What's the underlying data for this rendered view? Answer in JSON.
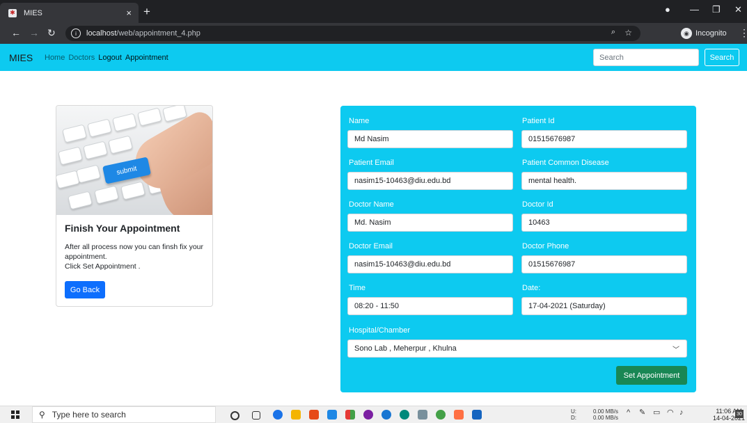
{
  "browser": {
    "tab_title": "MIES",
    "tab_close": "×",
    "new_tab": "+",
    "url_host": "localhost",
    "url_path": "/web/appointment_4.php",
    "incognito_label": "Incognito"
  },
  "navbar": {
    "brand": "MIES",
    "links": [
      "Home",
      "Doctors",
      "Logout",
      "Appointment"
    ],
    "search_placeholder": "Search",
    "search_button": "Search",
    "bg_color": "#0dcaf0"
  },
  "card": {
    "image_key_label": "submit",
    "title": "Finish Your Appointment",
    "text_line1": "After all process now you can finsh fix your appointment.",
    "text_line2": "Click Set Appointment .",
    "button": "Go Back"
  },
  "form": {
    "name_label": "Name",
    "name_value": "Md Nasim",
    "patient_id_label": "Patient Id",
    "patient_id_value": "01515676987",
    "patient_email_label": "Patient Email",
    "patient_email_value": "nasim15-10463@diu.edu.bd",
    "disease_label": "Patient Common Disease",
    "disease_value": "mental health.",
    "doctor_name_label": "Doctor Name",
    "doctor_name_value": "Md. Nasim",
    "doctor_id_label": "Doctor Id",
    "doctor_id_value": "10463",
    "doctor_email_label": "Doctor Email",
    "doctor_email_value": "nasim15-10463@diu.edu.bd",
    "doctor_phone_label": "Doctor Phone",
    "doctor_phone_value": "01515676987",
    "time_label": "Time",
    "time_value": "08:20 - 11:50",
    "date_label": "Date:",
    "date_value": "17-04-2021 (Saturday)",
    "hospital_label": "Hospital/Chamber",
    "hospital_value": "Sono Lab , Meherpur , Khulna",
    "submit_button": "Set Appointment"
  },
  "taskbar": {
    "search_placeholder": "Type here to search",
    "net_up": "0.00 MB/s",
    "net_down": "0.00 MB/s",
    "net_up_label": "U:",
    "net_down_label": "D:",
    "time": "11:06 AM",
    "date": "14-04-2021",
    "notification_count": "30"
  }
}
